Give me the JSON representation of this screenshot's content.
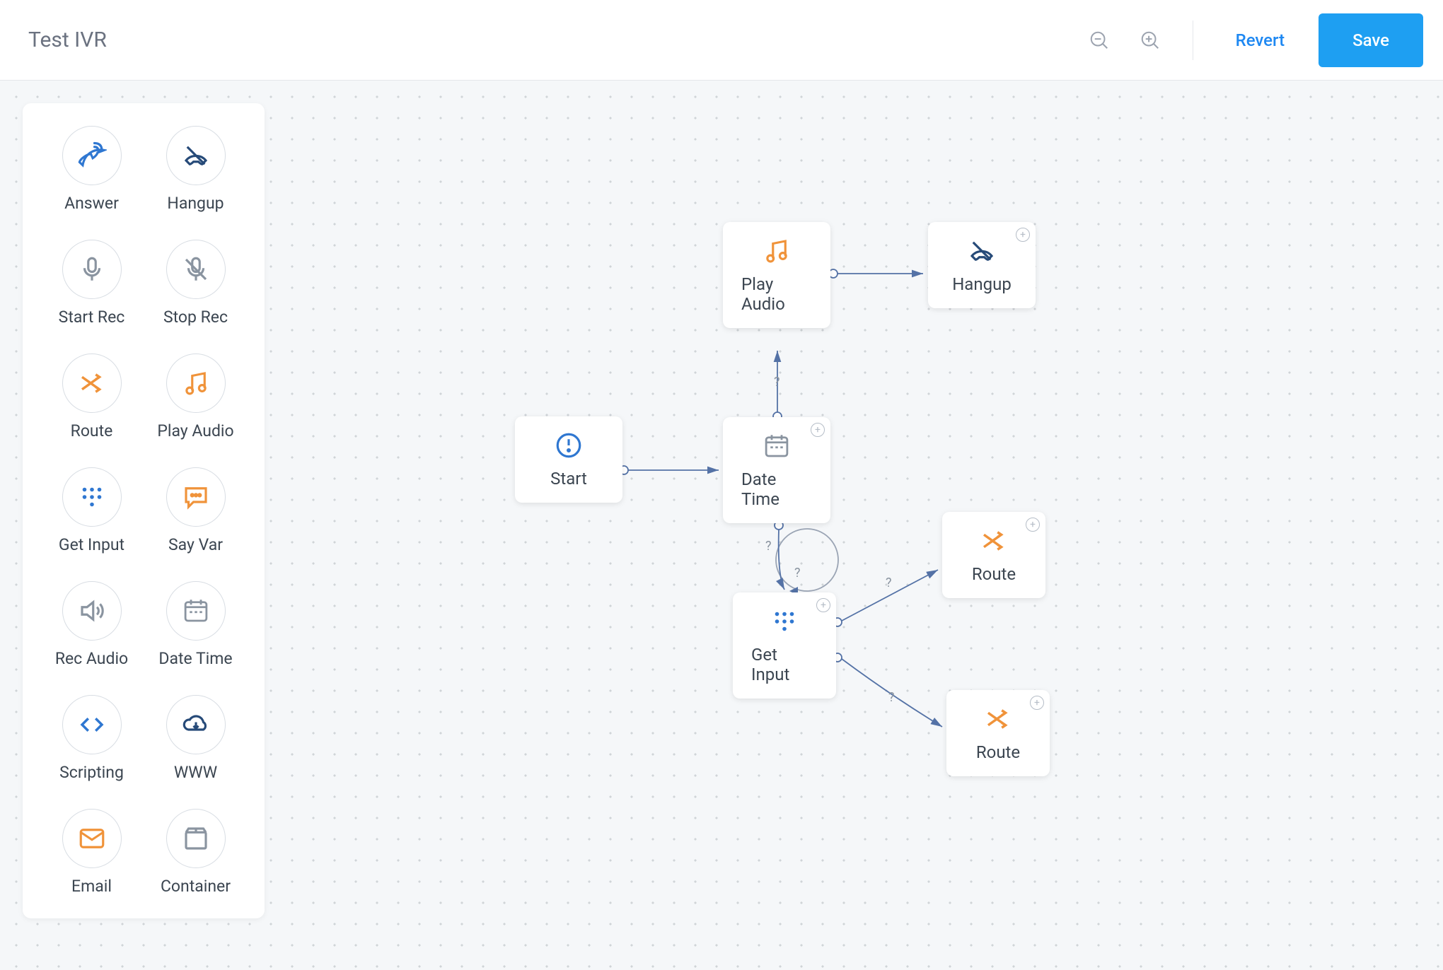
{
  "header": {
    "title": "Test IVR",
    "revert_label": "Revert",
    "save_label": "Save"
  },
  "palette": {
    "items": [
      {
        "id": "answer",
        "label": "Answer"
      },
      {
        "id": "hangup",
        "label": "Hangup"
      },
      {
        "id": "start-rec",
        "label": "Start Rec"
      },
      {
        "id": "stop-rec",
        "label": "Stop Rec"
      },
      {
        "id": "route",
        "label": "Route"
      },
      {
        "id": "play-audio",
        "label": "Play Audio"
      },
      {
        "id": "get-input",
        "label": "Get Input"
      },
      {
        "id": "say-var",
        "label": "Say Var"
      },
      {
        "id": "rec-audio",
        "label": "Rec Audio"
      },
      {
        "id": "date-time",
        "label": "Date Time"
      },
      {
        "id": "scripting",
        "label": "Scripting"
      },
      {
        "id": "www",
        "label": "WWW"
      },
      {
        "id": "email",
        "label": "Email"
      },
      {
        "id": "container",
        "label": "Container"
      }
    ]
  },
  "canvas": {
    "nodes": {
      "start": {
        "label": "Start"
      },
      "datetime": {
        "label": "Date Time"
      },
      "playaudio": {
        "label": "Play Audio"
      },
      "hangup": {
        "label": "Hangup"
      },
      "getinput": {
        "label": "Get Input"
      },
      "route1": {
        "label": "Route"
      },
      "route2": {
        "label": "Route"
      }
    },
    "edge_labels": {
      "dt_to_play": "?",
      "dt_to_getinput_a": "?",
      "dt_to_getinput_b": "?",
      "gi_to_route1": "?",
      "gi_to_route2": "?"
    }
  }
}
